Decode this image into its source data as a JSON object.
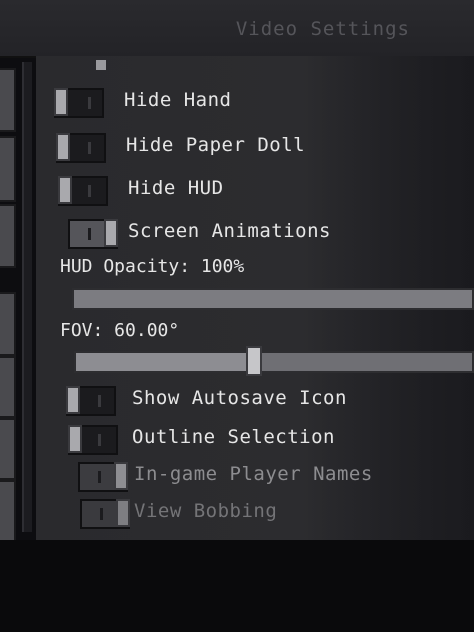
{
  "window": {
    "title": "Video Settings"
  },
  "settings": [
    {
      "key": "hide_hand",
      "label": "Hide Hand",
      "on": false
    },
    {
      "key": "hide_paper_doll",
      "label": "Hide Paper Doll",
      "on": false
    },
    {
      "key": "hide_hud",
      "label": "Hide HUD",
      "on": false
    },
    {
      "key": "screen_animations",
      "label": "Screen Animations",
      "on": true
    }
  ],
  "hud_opacity": {
    "label": "HUD Opacity: 100%",
    "value": 1.0
  },
  "fov": {
    "label": "FOV: 60.00°",
    "value": 0.45
  },
  "more_settings": [
    {
      "key": "show_autosave_icon",
      "label": "Show Autosave Icon",
      "on": false
    },
    {
      "key": "outline_selection",
      "label": "Outline Selection",
      "on": false
    },
    {
      "key": "ingame_player_names",
      "label": "In-game Player Names",
      "on": true
    },
    {
      "key": "view_bobbing",
      "label": "View Bobbing",
      "on": true
    }
  ]
}
